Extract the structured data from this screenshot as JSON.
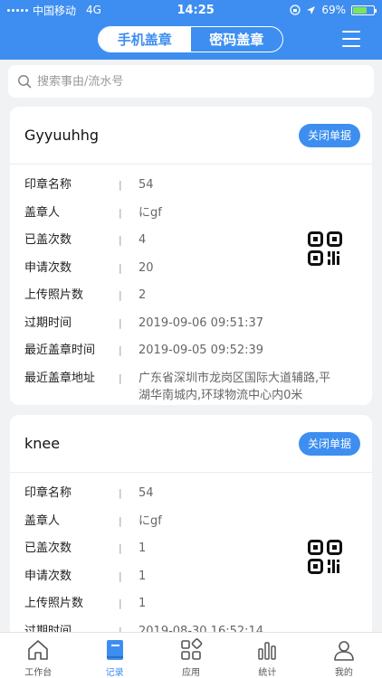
{
  "status_bar": {
    "carrier": "中国移动",
    "network": "4G",
    "time": "14:25",
    "battery_percent": "69%",
    "battery_level": 0.69
  },
  "nav": {
    "segments": [
      "手机盖章",
      "密码盖章"
    ],
    "active_segment": 0
  },
  "search": {
    "placeholder": "搜索事由/流水号"
  },
  "colors": {
    "accent": "#3d8ef0",
    "battery": "#7ee35a"
  },
  "labels": {
    "seal_name": "印章名称",
    "stamper": "盖章人",
    "stamped_count": "已盖次数",
    "applied_count": "申请次数",
    "photo_count": "上传照片数",
    "expire_time": "过期时间",
    "last_stamp_time": "最近盖章时间",
    "last_stamp_address": "最近盖章地址",
    "separator": "|"
  },
  "cards": [
    {
      "title": "Gyyuuhhg",
      "button": "关闭单据",
      "seal_name": "54",
      "stamper": "にgf",
      "stamped_count": "4",
      "applied_count": "20",
      "photo_count": "2",
      "expire_time": "2019-09-06 09:51:37",
      "last_stamp_time": "2019-09-05 09:52:39",
      "last_stamp_address": "广东省深圳市龙岗区国际大道辅路,平湖华南城内,环球物流中心内0米"
    },
    {
      "title": "knee",
      "button": "关闭单据",
      "seal_name": "54",
      "stamper": "にgf",
      "stamped_count": "1",
      "applied_count": "1",
      "photo_count": "1",
      "expire_time": "2019-08-30 16:52:14"
    }
  ],
  "tabbar": {
    "items": [
      {
        "label": "工作台",
        "icon": "home-icon"
      },
      {
        "label": "记录",
        "icon": "record-icon"
      },
      {
        "label": "应用",
        "icon": "apps-icon"
      },
      {
        "label": "统计",
        "icon": "chart-icon"
      },
      {
        "label": "我的",
        "icon": "user-icon"
      }
    ],
    "active_index": 1
  }
}
